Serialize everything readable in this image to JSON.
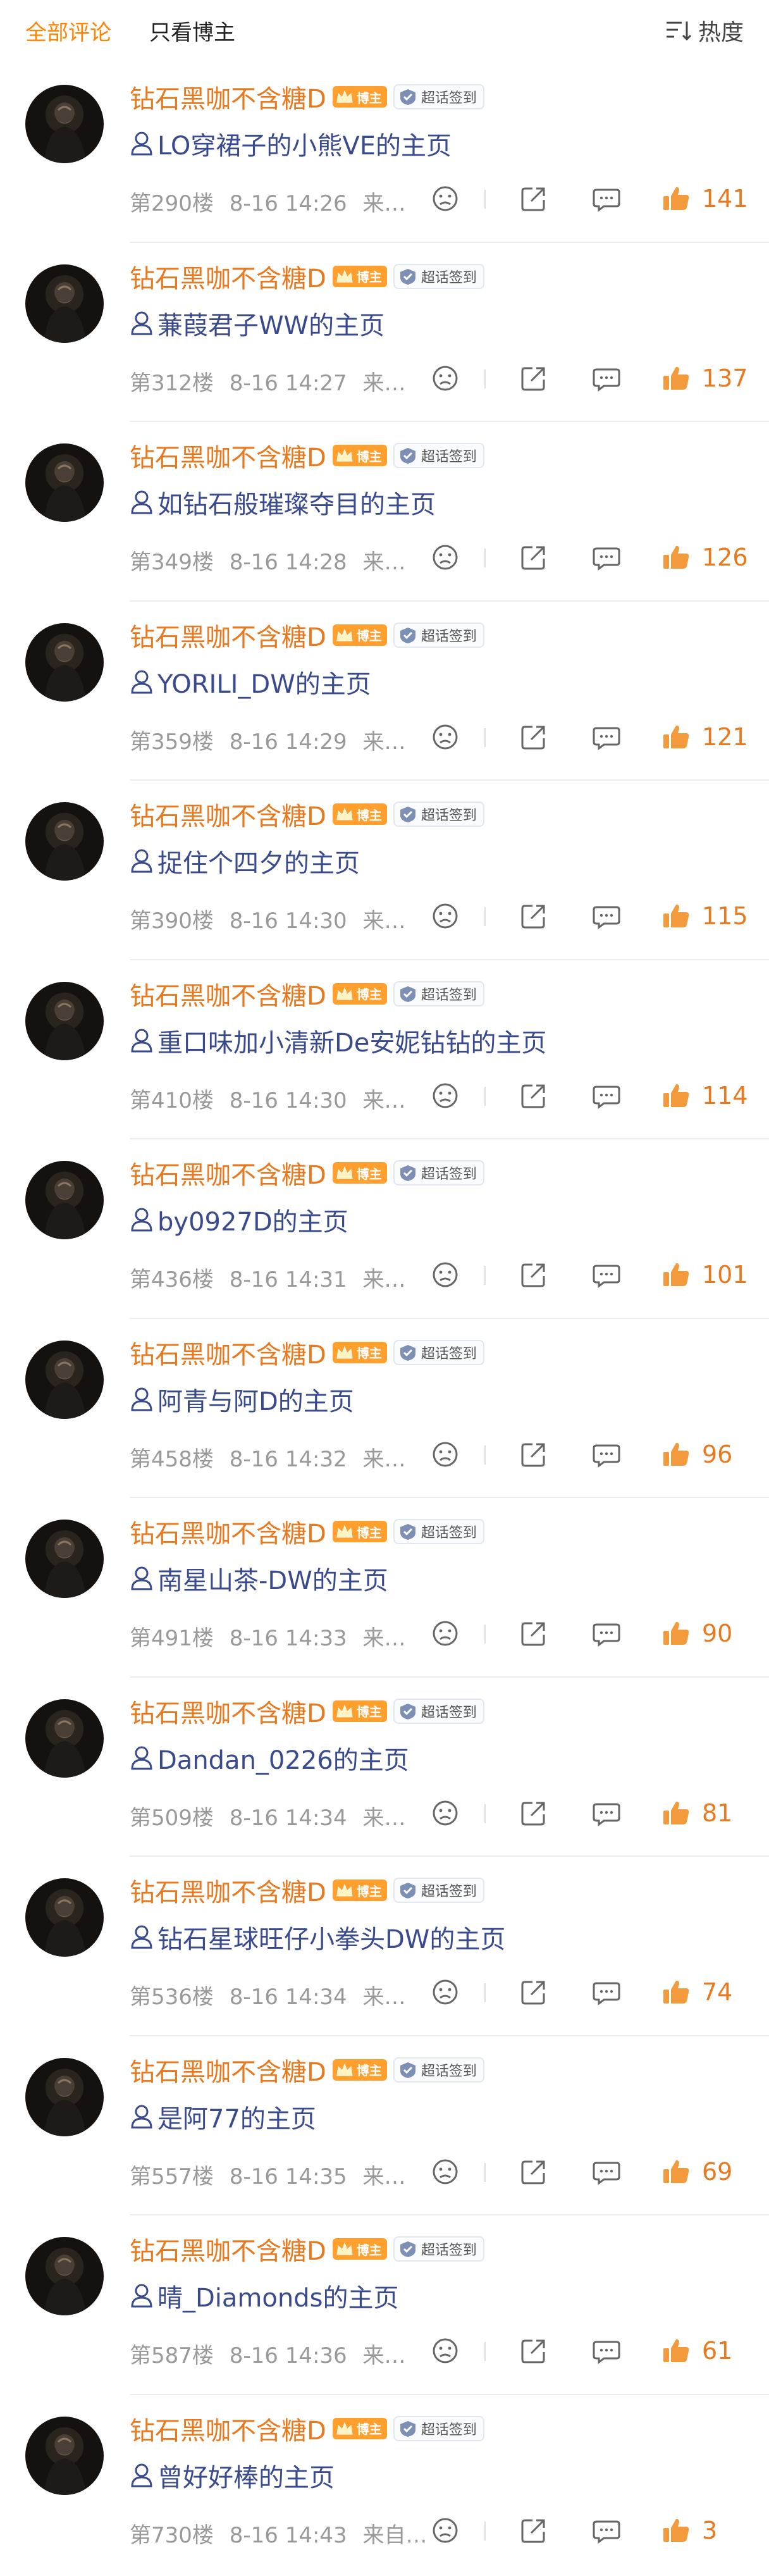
{
  "tabs": {
    "all": "全部评论",
    "host_only": "只看博主"
  },
  "sort": {
    "label": "热度",
    "icon": "sort-icon"
  },
  "user": {
    "name": "钻石黑咖不含糖D",
    "boss_badge": "博主",
    "checkin_badge": "超话签到"
  },
  "colors": {
    "accent": "#ff8200",
    "username": "#e8791e",
    "link": "#3a4a8e"
  },
  "comments": [
    {
      "text": "LO穿裙子的小熊VE的主页",
      "floor": "第290楼",
      "time": "8-16 14:26",
      "source": "来…",
      "likes": "141"
    },
    {
      "text": "蒹葭君子WW的主页",
      "floor": "第312楼",
      "time": "8-16 14:27",
      "source": "来…",
      "likes": "137"
    },
    {
      "text": "如钻石般璀璨夺目的主页",
      "floor": "第349楼",
      "time": "8-16 14:28",
      "source": "来…",
      "likes": "126"
    },
    {
      "text": "YORILI_DW的主页",
      "floor": "第359楼",
      "time": "8-16 14:29",
      "source": "来…",
      "likes": "121"
    },
    {
      "text": "捉住个四夕的主页",
      "floor": "第390楼",
      "time": "8-16 14:30",
      "source": "来…",
      "likes": "115"
    },
    {
      "text": "重口味加小清新De安妮钻钻的主页",
      "floor": "第410楼",
      "time": "8-16 14:30",
      "source": "来…",
      "likes": "114"
    },
    {
      "text": "by0927D的主页",
      "floor": "第436楼",
      "time": "8-16 14:31",
      "source": "来…",
      "likes": "101"
    },
    {
      "text": "阿青与阿D的主页",
      "floor": "第458楼",
      "time": "8-16 14:32",
      "source": "来…",
      "likes": "96"
    },
    {
      "text": "南星山茶-DW的主页",
      "floor": "第491楼",
      "time": "8-16 14:33",
      "source": "来…",
      "likes": "90"
    },
    {
      "text": "Dandan_0226的主页",
      "floor": "第509楼",
      "time": "8-16 14:34",
      "source": "来…",
      "likes": "81"
    },
    {
      "text": "钻石星球旺仔小拳头DW的主页",
      "floor": "第536楼",
      "time": "8-16 14:34",
      "source": "来…",
      "likes": "74"
    },
    {
      "text": "是阿77的主页",
      "floor": "第557楼",
      "time": "8-16 14:35",
      "source": "来…",
      "likes": "69"
    },
    {
      "text": "晴_Diamonds的主页",
      "floor": "第587楼",
      "time": "8-16 14:36",
      "source": "来…",
      "likes": "61"
    },
    {
      "text": "曾好好棒的主页",
      "floor": "第730楼",
      "time": "8-16 14:43",
      "source": "来自…",
      "likes": "3"
    }
  ]
}
